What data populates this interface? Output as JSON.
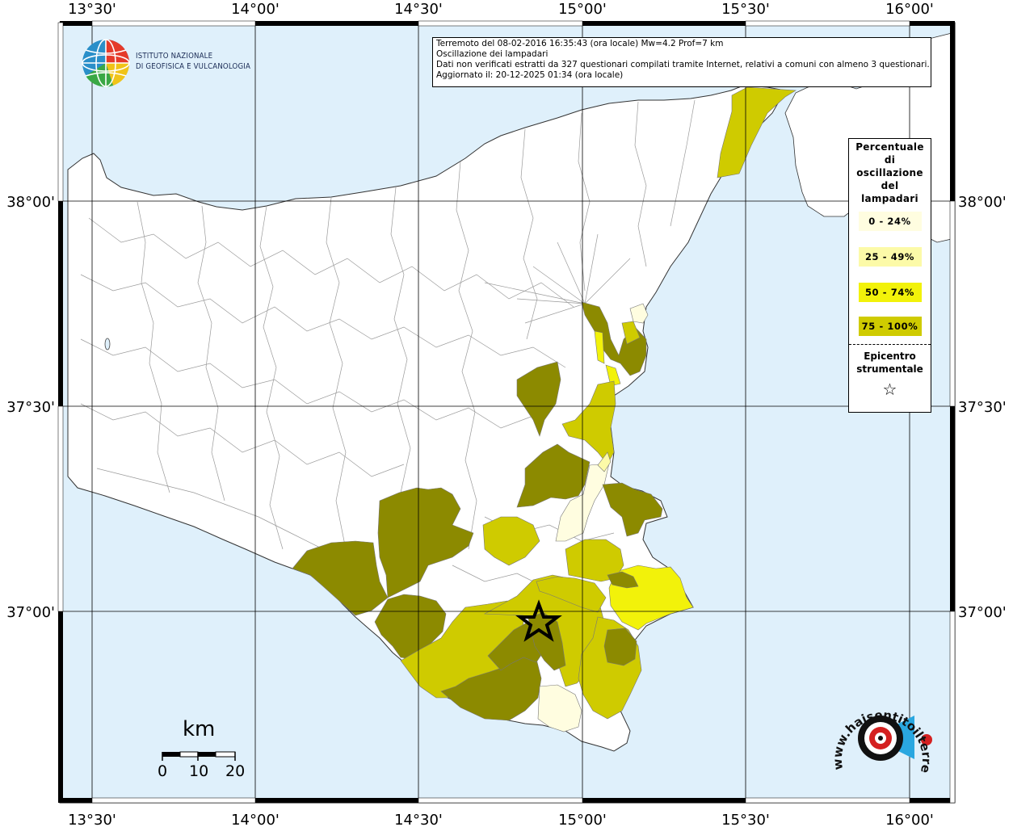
{
  "map": {
    "top_lon_ticks": [
      "13°30'",
      "14°00'",
      "14°30'",
      "15°00'",
      "15°30'",
      "16°00'"
    ],
    "bottom_lon_ticks": [
      "13°30'",
      "14°00'",
      "14°30'",
      "15°00'",
      "15°30'",
      "16°00'"
    ],
    "left_lat_ticks": [
      "38°00'",
      "37°30'",
      "37°00'"
    ],
    "right_lat_ticks": [
      "38°00'",
      "37°30'",
      "37°00'"
    ],
    "colors": {
      "sea": "#dff0fb",
      "land": "#ffffff",
      "c0_24": "#fffde0",
      "c25_49": "#fcfaa8",
      "c50_74": "#f2f20a",
      "c75_100": "#cfcb00",
      "dark": "#8c8a00",
      "border": "#999999"
    }
  },
  "info": {
    "line1": "Terremoto del 08-02-2016 16:35:43 (ora locale) Mw=4.2 Prof=7 km",
    "line2": "Oscillazione dei lampadari",
    "line3": "Dati non verificati estratti da 327 questionari compilati tramite Internet, relativi a comuni con almeno 3 questionari.",
    "line4": "Aggiornato il: 20-12-2025 01:34 (ora locale)"
  },
  "legend": {
    "title_lines": [
      "Percentuale",
      "di",
      "oscillazione",
      "del",
      "lampadari"
    ],
    "items": [
      {
        "label": "0 - 24%",
        "color": "#fffde0"
      },
      {
        "label": "25 - 49%",
        "color": "#fcfaa8"
      },
      {
        "label": "50 - 74%",
        "color": "#f2f20a"
      },
      {
        "label": "75 - 100%",
        "color": "#cfcb00"
      }
    ],
    "epicenter_lines": [
      "Epicentro",
      "strumentale"
    ],
    "epicenter_symbol": "☆"
  },
  "ingv": {
    "line1": "ISTITUTO NAZIONALE",
    "line2": "DI GEOFISICA E VULCANOLOGIA"
  },
  "scale": {
    "unit": "km",
    "labels": [
      "0",
      "10",
      "20"
    ]
  },
  "hsit": {
    "text": "www.haisentitoilterremoto.it"
  }
}
